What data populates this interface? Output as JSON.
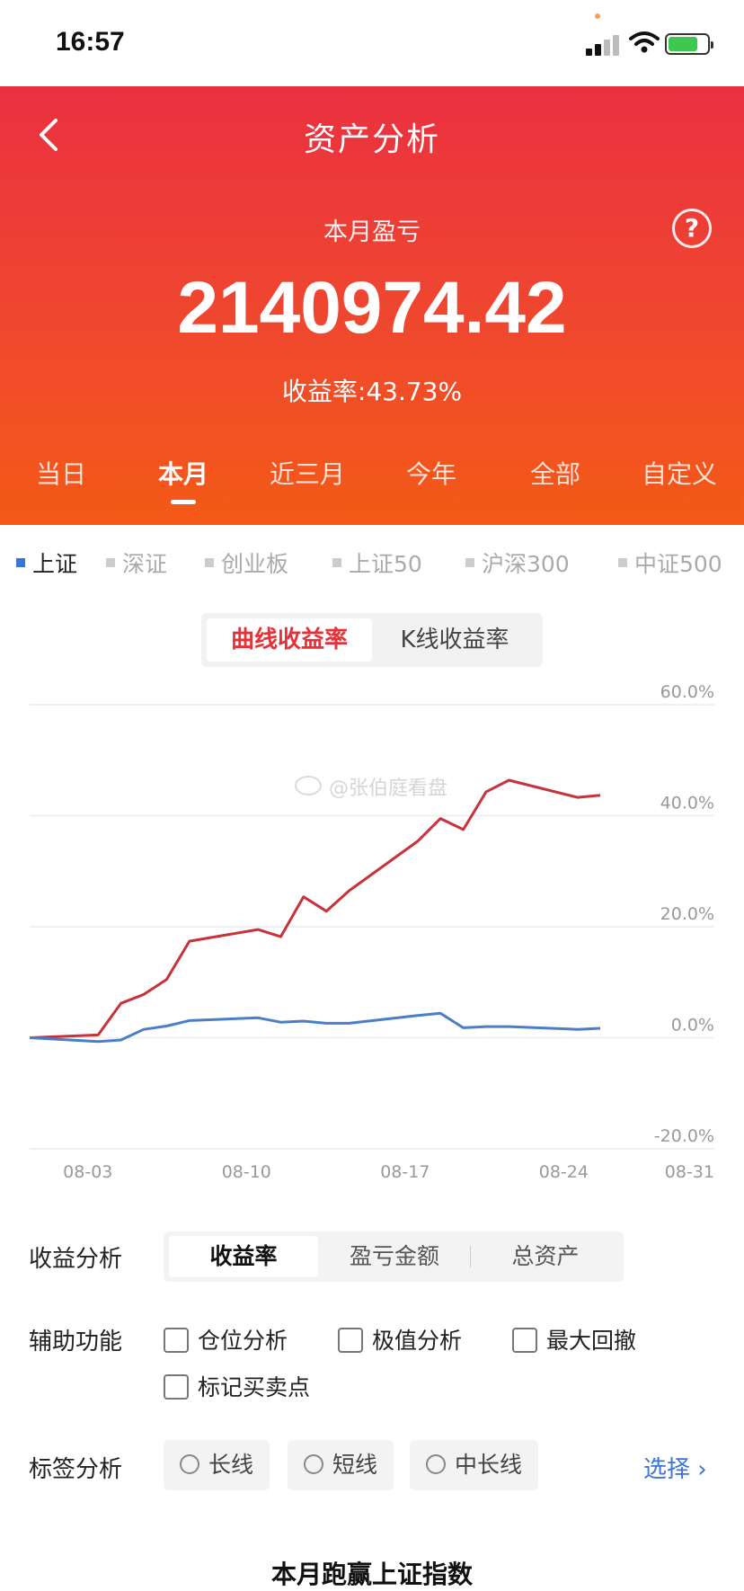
{
  "status": {
    "time": "16:57"
  },
  "header": {
    "title": "资产分析",
    "sublabel": "本月盈亏",
    "amount": "2140974.42",
    "rate": "收益率:43.73%",
    "help_glyph": "?",
    "tabs": [
      "当日",
      "本月",
      "近三月",
      "今年",
      "全部",
      "自定义"
    ],
    "active_tab": 1
  },
  "indices": {
    "items": [
      "上证",
      "深证",
      "创业板",
      "上证50",
      "沪深300",
      "中证500"
    ],
    "active": 0,
    "active_color": "#3b74d8"
  },
  "chart_toggle": {
    "options": [
      "曲线收益率",
      "K线收益率"
    ],
    "active": 0
  },
  "watermark": "@张伯庭看盘",
  "chart_data": {
    "type": "line",
    "x": [
      "08-01",
      "08-04",
      "08-05",
      "08-06",
      "08-07",
      "08-08",
      "08-11",
      "08-12",
      "08-13",
      "08-14",
      "08-15",
      "08-18",
      "08-19",
      "08-20",
      "08-21",
      "08-22",
      "08-25",
      "08-26"
    ],
    "x_ticks": [
      "08-03",
      "08-10",
      "08-17",
      "08-24",
      "08-31"
    ],
    "y_ticks": [
      "60.0%",
      "40.0%",
      "20.0%",
      "0.0%",
      "-20.0%"
    ],
    "ylim": [
      -20,
      60
    ],
    "series": [
      {
        "color": "#c8323a",
        "values": [
          0.0,
          0.5,
          6.2,
          7.8,
          10.5,
          17.4,
          19.5,
          18.2,
          25.4,
          22.8,
          26.5,
          35.4,
          39.5,
          37.5,
          44.3,
          46.4,
          43.3,
          43.7
        ]
      },
      {
        "color": "#4a7fc8",
        "values": [
          0.0,
          -0.7,
          -0.4,
          1.5,
          2.1,
          3.1,
          3.6,
          2.8,
          3.0,
          2.6,
          2.6,
          4.0,
          4.4,
          1.8,
          2.0,
          2.0,
          1.5,
          1.7
        ]
      }
    ],
    "x_positions": [
      0,
      3,
      4,
      5,
      6,
      7,
      10,
      11,
      12,
      13,
      14,
      17,
      18,
      19,
      20,
      21,
      24,
      25
    ],
    "x_min": 0,
    "x_max": 30,
    "grid": true
  },
  "analysis": {
    "label": "收益分析",
    "options": [
      "收益率",
      "盈亏金额",
      "总资产"
    ],
    "active": 0
  },
  "aux": {
    "label": "辅助功能",
    "options": [
      "仓位分析",
      "极值分析",
      "最大回撤",
      "标记买卖点"
    ]
  },
  "tags": {
    "label": "标签分析",
    "options": [
      "长线",
      "短线",
      "中长线"
    ],
    "select_label": "选择"
  },
  "bottom_title": "本月跑赢上证指数"
}
